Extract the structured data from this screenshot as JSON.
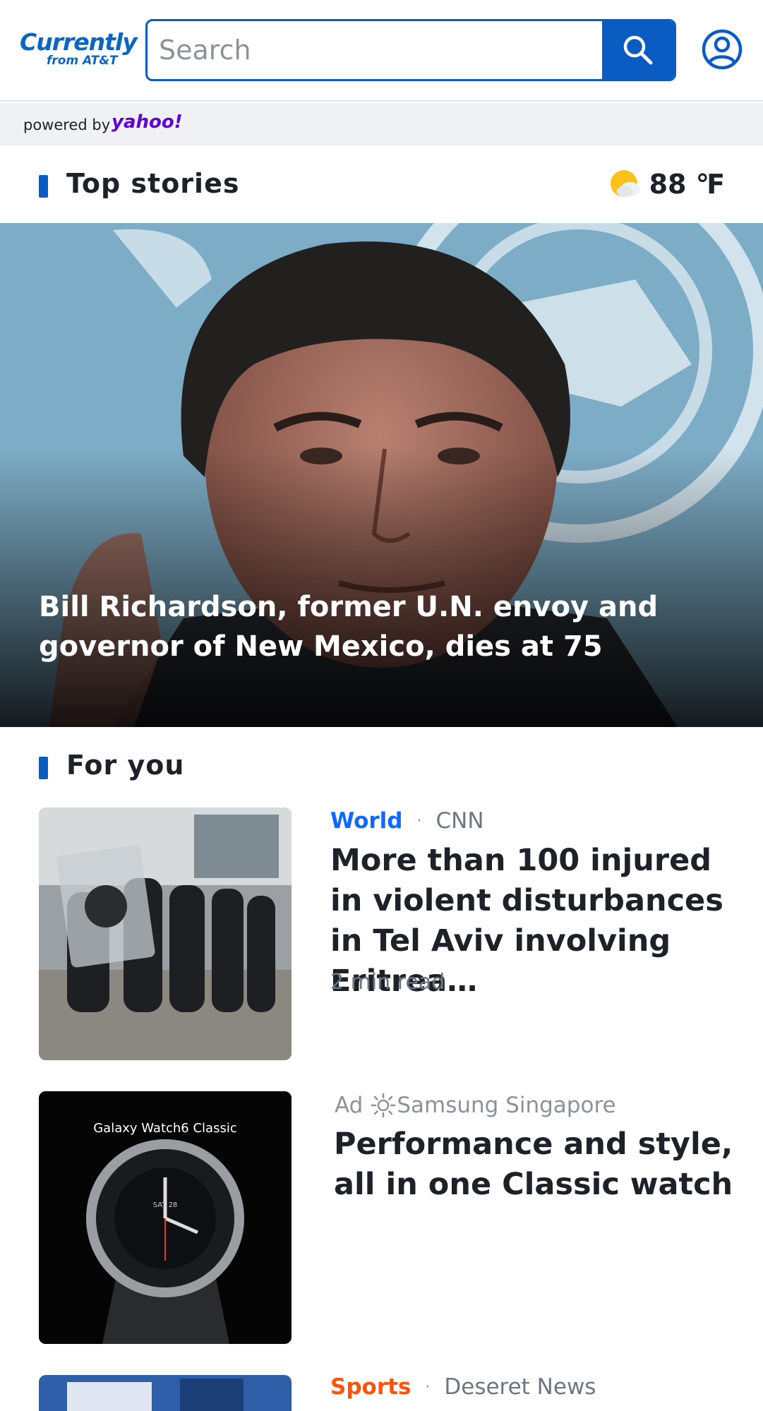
{
  "header": {
    "logo_main": "Currently",
    "logo_sub": "from AT&T",
    "search_placeholder": "Search"
  },
  "powered_bar": {
    "text": "powered by",
    "brand": "yahoo!"
  },
  "top_stories": {
    "title": "Top stories",
    "weather_temp": "88 ℉",
    "hero_headline": "Bill Richardson, former U.N. envoy and governor of New Mexico, dies at 75"
  },
  "for_you": {
    "title": "For you",
    "articles": [
      {
        "category": "World",
        "separator": "·",
        "source": "CNN",
        "headline": "More than 100 injured in violent disturbances in Tel Aviv involving Eritrea…",
        "read_time": "2 min read",
        "category_color": "#0f69ff"
      },
      {
        "ad_label": "Ad",
        "source": "Samsung Singapore",
        "headline": "Performance and style, all in one Classic watch",
        "thumb_text": "Galaxy Watch6 Classic",
        "watch_date": "SAT 28"
      },
      {
        "category": "Sports",
        "separator": "·",
        "source": "Deseret News",
        "category_color": "#ff520d"
      }
    ]
  },
  "colors": {
    "accent": "#0a5cc2",
    "world": "#0f69ff",
    "sports": "#ff520d",
    "yahoo": "#6001d2"
  }
}
